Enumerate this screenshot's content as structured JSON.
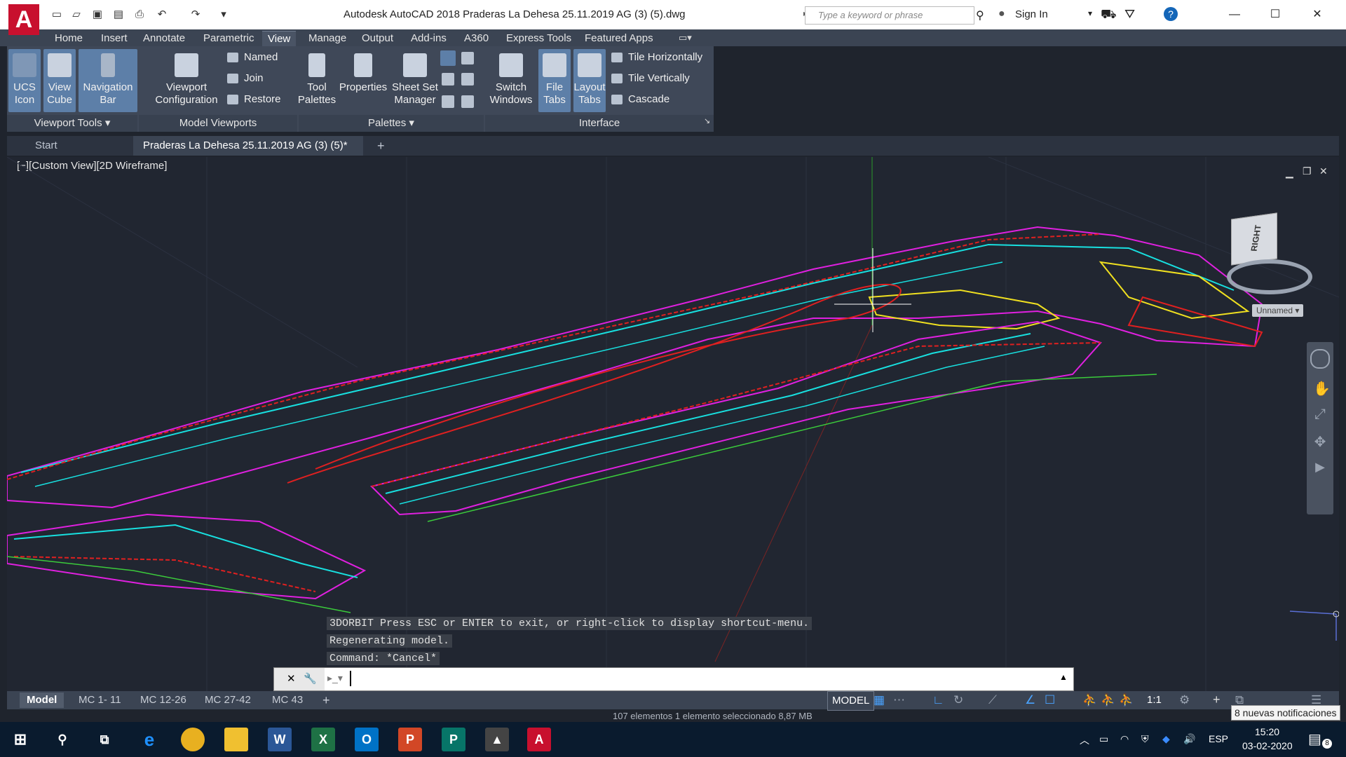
{
  "titlebar": {
    "app_logo": "A",
    "title": "Autodesk AutoCAD 2018     Praderas La Dehesa 25.11.2019 AG (3) (5).dwg",
    "search_placeholder": "Type a keyword or phrase",
    "sign_in": "Sign In"
  },
  "ribbon_tabs": [
    "Home",
    "Insert",
    "Annotate",
    "Parametric",
    "View",
    "Manage",
    "Output",
    "Add-ins",
    "A360",
    "Express Tools",
    "Featured Apps"
  ],
  "ribbon": {
    "viewport_tools": {
      "ucs": "UCS Icon",
      "viewcube": "View Cube",
      "navbar": "Navigation Bar",
      "title": "Viewport Tools"
    },
    "model_viewports": {
      "config": "Viewport Configuration",
      "named": "Named",
      "join": "Join",
      "restore": "Restore",
      "title": "Model Viewports"
    },
    "palettes": {
      "tool": "Tool Palettes",
      "properties": "Properties",
      "sheetset": "Sheet Set Manager",
      "title": "Palettes"
    },
    "interface": {
      "switch": "Switch Windows",
      "filetabs": "File Tabs",
      "layouttabs": "Layout Tabs",
      "tile_h": "Tile Horizontally",
      "tile_v": "Tile Vertically",
      "cascade": "Cascade",
      "title": "Interface"
    }
  },
  "file_tabs": {
    "start": "Start",
    "doc": "Praderas La Dehesa 25.11.2019 AG (3) (5)*"
  },
  "viewport": {
    "label": "[−][Custom View][2D Wireframe]",
    "viewcube_face": "RIGHT",
    "viewcube_ucs": "Unnamed",
    "command_history": [
      "3DORBIT Press ESC or ENTER to exit, or right-click to display shortcut-menu.",
      "Regenerating model.",
      "Command: *Cancel*"
    ]
  },
  "layout_tabs": [
    "Model",
    "MC 1- 11",
    "MC 12-26",
    "MC 27-42",
    "MC 43"
  ],
  "status": {
    "model": "MODEL",
    "scale": "1:1",
    "selection": "107 elementos     1 elemento seleccionado  8,87 MB"
  },
  "notification": "8 nuevas notificaciones",
  "taskbar": {
    "lang": "ESP",
    "time": "15:20",
    "date": "03-02-2020",
    "badge": "8"
  },
  "colors": {
    "brand": "#c8102e",
    "ribbon_bg": "#3f4858",
    "canvas_bg": "#212631",
    "cyan": "#18e0e0",
    "magenta": "#e020e0",
    "red": "#e02020",
    "yellow": "#f0e020"
  }
}
